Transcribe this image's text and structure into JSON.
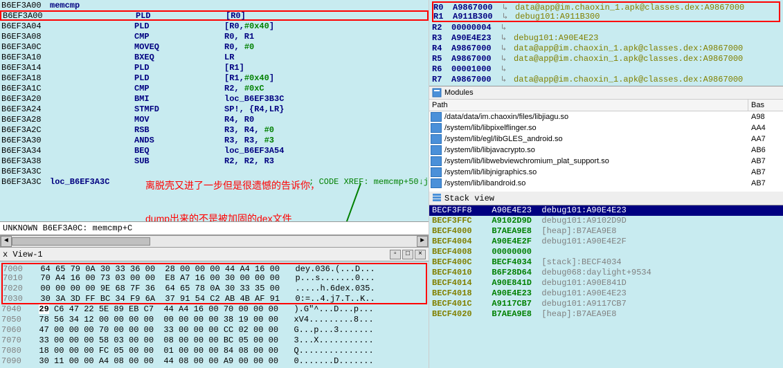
{
  "disasm": {
    "header": {
      "addr": "B6EF3A00",
      "label": "memcmp"
    },
    "rows": [
      {
        "addr": "B6EF3A00",
        "mn": "PLD",
        "op_html": "[R0]"
      },
      {
        "addr": "B6EF3A04",
        "mn": "PLD",
        "op_html": "[R0,<span class='num'>#0x40</span>]"
      },
      {
        "addr": "B6EF3A08",
        "mn": "CMP",
        "op_html": "R0, R1"
      },
      {
        "addr": "B6EF3A0C",
        "mn": "MOVEQ",
        "op_html": "R0, <span class='num'>#0</span>"
      },
      {
        "addr": "B6EF3A10",
        "mn": "BXEQ",
        "op_html": "LR"
      },
      {
        "addr": "B6EF3A14",
        "mn": "PLD",
        "op_html": "[R1]"
      },
      {
        "addr": "B6EF3A18",
        "mn": "PLD",
        "op_html": "[R1,<span class='num'>#0x40</span>]"
      },
      {
        "addr": "B6EF3A1C",
        "mn": "CMP",
        "op_html": "R2, <span class='num'>#0xC</span>"
      },
      {
        "addr": "B6EF3A20",
        "mn": "BMI",
        "op_html": "loc_B6EF3B3C"
      },
      {
        "addr": "B6EF3A24",
        "mn": "STMFD",
        "op_html": "SP!, {R4,LR}"
      },
      {
        "addr": "B6EF3A28",
        "mn": "MOV",
        "op_html": "R4, R0"
      },
      {
        "addr": "B6EF3A2C",
        "mn": "RSB",
        "op_html": "R3, R4, <span class='num'>#0</span>"
      },
      {
        "addr": "B6EF3A30",
        "mn": "ANDS",
        "op_html": "R3, R3, <span class='num'>#3</span>"
      },
      {
        "addr": "B6EF3A34",
        "mn": "BEQ",
        "op_html": "loc_B6EF3A54"
      },
      {
        "addr": "B6EF3A38",
        "mn": "SUB",
        "op_html": "R2, R2, R3"
      },
      {
        "addr": "B6EF3A3C",
        "mn": "",
        "op_html": ""
      },
      {
        "addr": "B6EF3A3C",
        "label": "loc_B6EF3A3C",
        "xref": "; CODE XREF: memcmp+50↓j"
      }
    ],
    "highlight_addr": "B6EF3A0C",
    "annotation1": "离脱壳又进了一步但是很遗憾的告诉你，",
    "annotation2": "dump出来的不是被加固的dex文件",
    "status": "UNKNOWN B6EF3A0C: memcmp+C"
  },
  "hex_tab": "x View-1",
  "hex": {
    "rows": [
      {
        "off": "7000",
        "bytes": "64 65 79 0A 30 33 36 00  28 00 00 00 44 A4 16 00",
        "ascii": "dey.036.(...D..."
      },
      {
        "off": "7010",
        "bytes": "70 A4 16 00 73 03 00 00  E8 A7 16 00 30 00 00 00",
        "ascii": "p...s.......0..."
      },
      {
        "off": "7020",
        "bytes": "00 00 00 00 9E 68 7F 36  64 65 78 0A 30 33 35 00",
        "ascii": ".....h.6dex.035."
      },
      {
        "off": "7030",
        "bytes": "30 3A 3D FF BC 34 F9 6A  37 91 54 C2 AB 4B AF 91",
        "ascii": "0:=..4.j7.T..K.."
      },
      {
        "off": "7040",
        "bytes": "<span class='hlbyte'>29</span> C6 47 22 5E 89 EB C7  44 A4 16 00 70 00 00 00",
        "ascii": ").G\"^...D...p..."
      },
      {
        "off": "7050",
        "bytes": "78 56 34 12 00 00 00 00  00 00 00 00 38 19 00 00",
        "ascii": "xV4.........8..."
      },
      {
        "off": "7060",
        "bytes": "47 00 00 00 70 00 00 00  33 00 00 00 CC 02 00 00",
        "ascii": "G...p...3......."
      },
      {
        "off": "7070",
        "bytes": "33 00 00 00 58 03 00 00  08 00 00 00 BC 05 00 00",
        "ascii": "3...X..........."
      },
      {
        "off": "7080",
        "bytes": "18 00 00 00 FC 05 00 00  01 00 00 00 84 08 00 00",
        "ascii": "Q..............."
      },
      {
        "off": "7090",
        "bytes": "30 11 00 00 A4 08 00 00  44 08 00 00 A9 00 00 00",
        "ascii": "0.......D......."
      }
    ],
    "redbox_rows": 4
  },
  "registers": {
    "rows": [
      {
        "name": "R0",
        "val": "A9867000",
        "arrow": true,
        "target": "data@app@im.chaoxin_1.apk@classes.dex:A9867000",
        "redbox": true
      },
      {
        "name": "R1",
        "val": "A911B300",
        "arrow": true,
        "target": "debug101:A911B300",
        "redbox": true
      },
      {
        "name": "R2",
        "val": "00000004",
        "arrow": true,
        "target": ""
      },
      {
        "name": "R3",
        "val": "A90E4E23",
        "arrow": true,
        "target": "debug101:A90E4E23"
      },
      {
        "name": "R4",
        "val": "A9867000",
        "arrow": true,
        "target": "data@app@im.chaoxin_1.apk@classes.dex:A9867000"
      },
      {
        "name": "R5",
        "val": "A9867000",
        "arrow": true,
        "target": "data@app@im.chaoxin_1.apk@classes.dex:A9867000"
      },
      {
        "name": "R6",
        "val": "00001000",
        "arrow": true,
        "target": ""
      },
      {
        "name": "R7",
        "val": "A9867000",
        "arrow": true,
        "target": "data@app@im.chaoxin_1.apk@classes.dex:A9867000"
      }
    ]
  },
  "modules": {
    "title": "Modules",
    "cols": {
      "path": "Path",
      "base": "Bas"
    },
    "items": [
      {
        "path": "/data/data/im.chaoxin/files/libjiagu.so",
        "base": "A98"
      },
      {
        "path": "/system/lib/libpixelflinger.so",
        "base": "AA4"
      },
      {
        "path": "/system/lib/egl/libGLES_android.so",
        "base": "AA7"
      },
      {
        "path": "/system/lib/libjavacrypto.so",
        "base": "AB6"
      },
      {
        "path": "/system/lib/libwebviewchromium_plat_support.so",
        "base": "AB7"
      },
      {
        "path": "/system/lib/libjnigraphics.so",
        "base": "AB7"
      },
      {
        "path": "/system/lib/libandroid.so",
        "base": "AB7"
      }
    ]
  },
  "stack": {
    "title": "Stack view",
    "rows": [
      {
        "addr": "BECF3FF8",
        "val": "A90E4E23",
        "target": "debug101:A90E4E23",
        "sel": true
      },
      {
        "addr": "BECF3FFC",
        "val": "A9102D9D",
        "target": "debug101:A9102D9D"
      },
      {
        "addr": "BECF4000",
        "val": "B7AEA9E8",
        "target": "[heap]:B7AEA9E8"
      },
      {
        "addr": "BECF4004",
        "val": "A90E4E2F",
        "target": "debug101:A90E4E2F"
      },
      {
        "addr": "BECF4008",
        "val": "00000000",
        "target": ""
      },
      {
        "addr": "BECF400C",
        "val": "BECF4034",
        "target": "[stack]:BECF4034"
      },
      {
        "addr": "BECF4010",
        "val": "B6F28D64",
        "target": "debug068:daylight+9534"
      },
      {
        "addr": "BECF4014",
        "val": "A90E841D",
        "target": "debug101:A90E841D"
      },
      {
        "addr": "BECF4018",
        "val": "A90E4E23",
        "target": "debug101:A90E4E23"
      },
      {
        "addr": "BECF401C",
        "val": "A9117CB7",
        "target": "debug101:A9117CB7"
      },
      {
        "addr": "BECF4020",
        "val": "B7AEA9E8",
        "target": "[heap]:B7AEA9E8"
      }
    ]
  }
}
